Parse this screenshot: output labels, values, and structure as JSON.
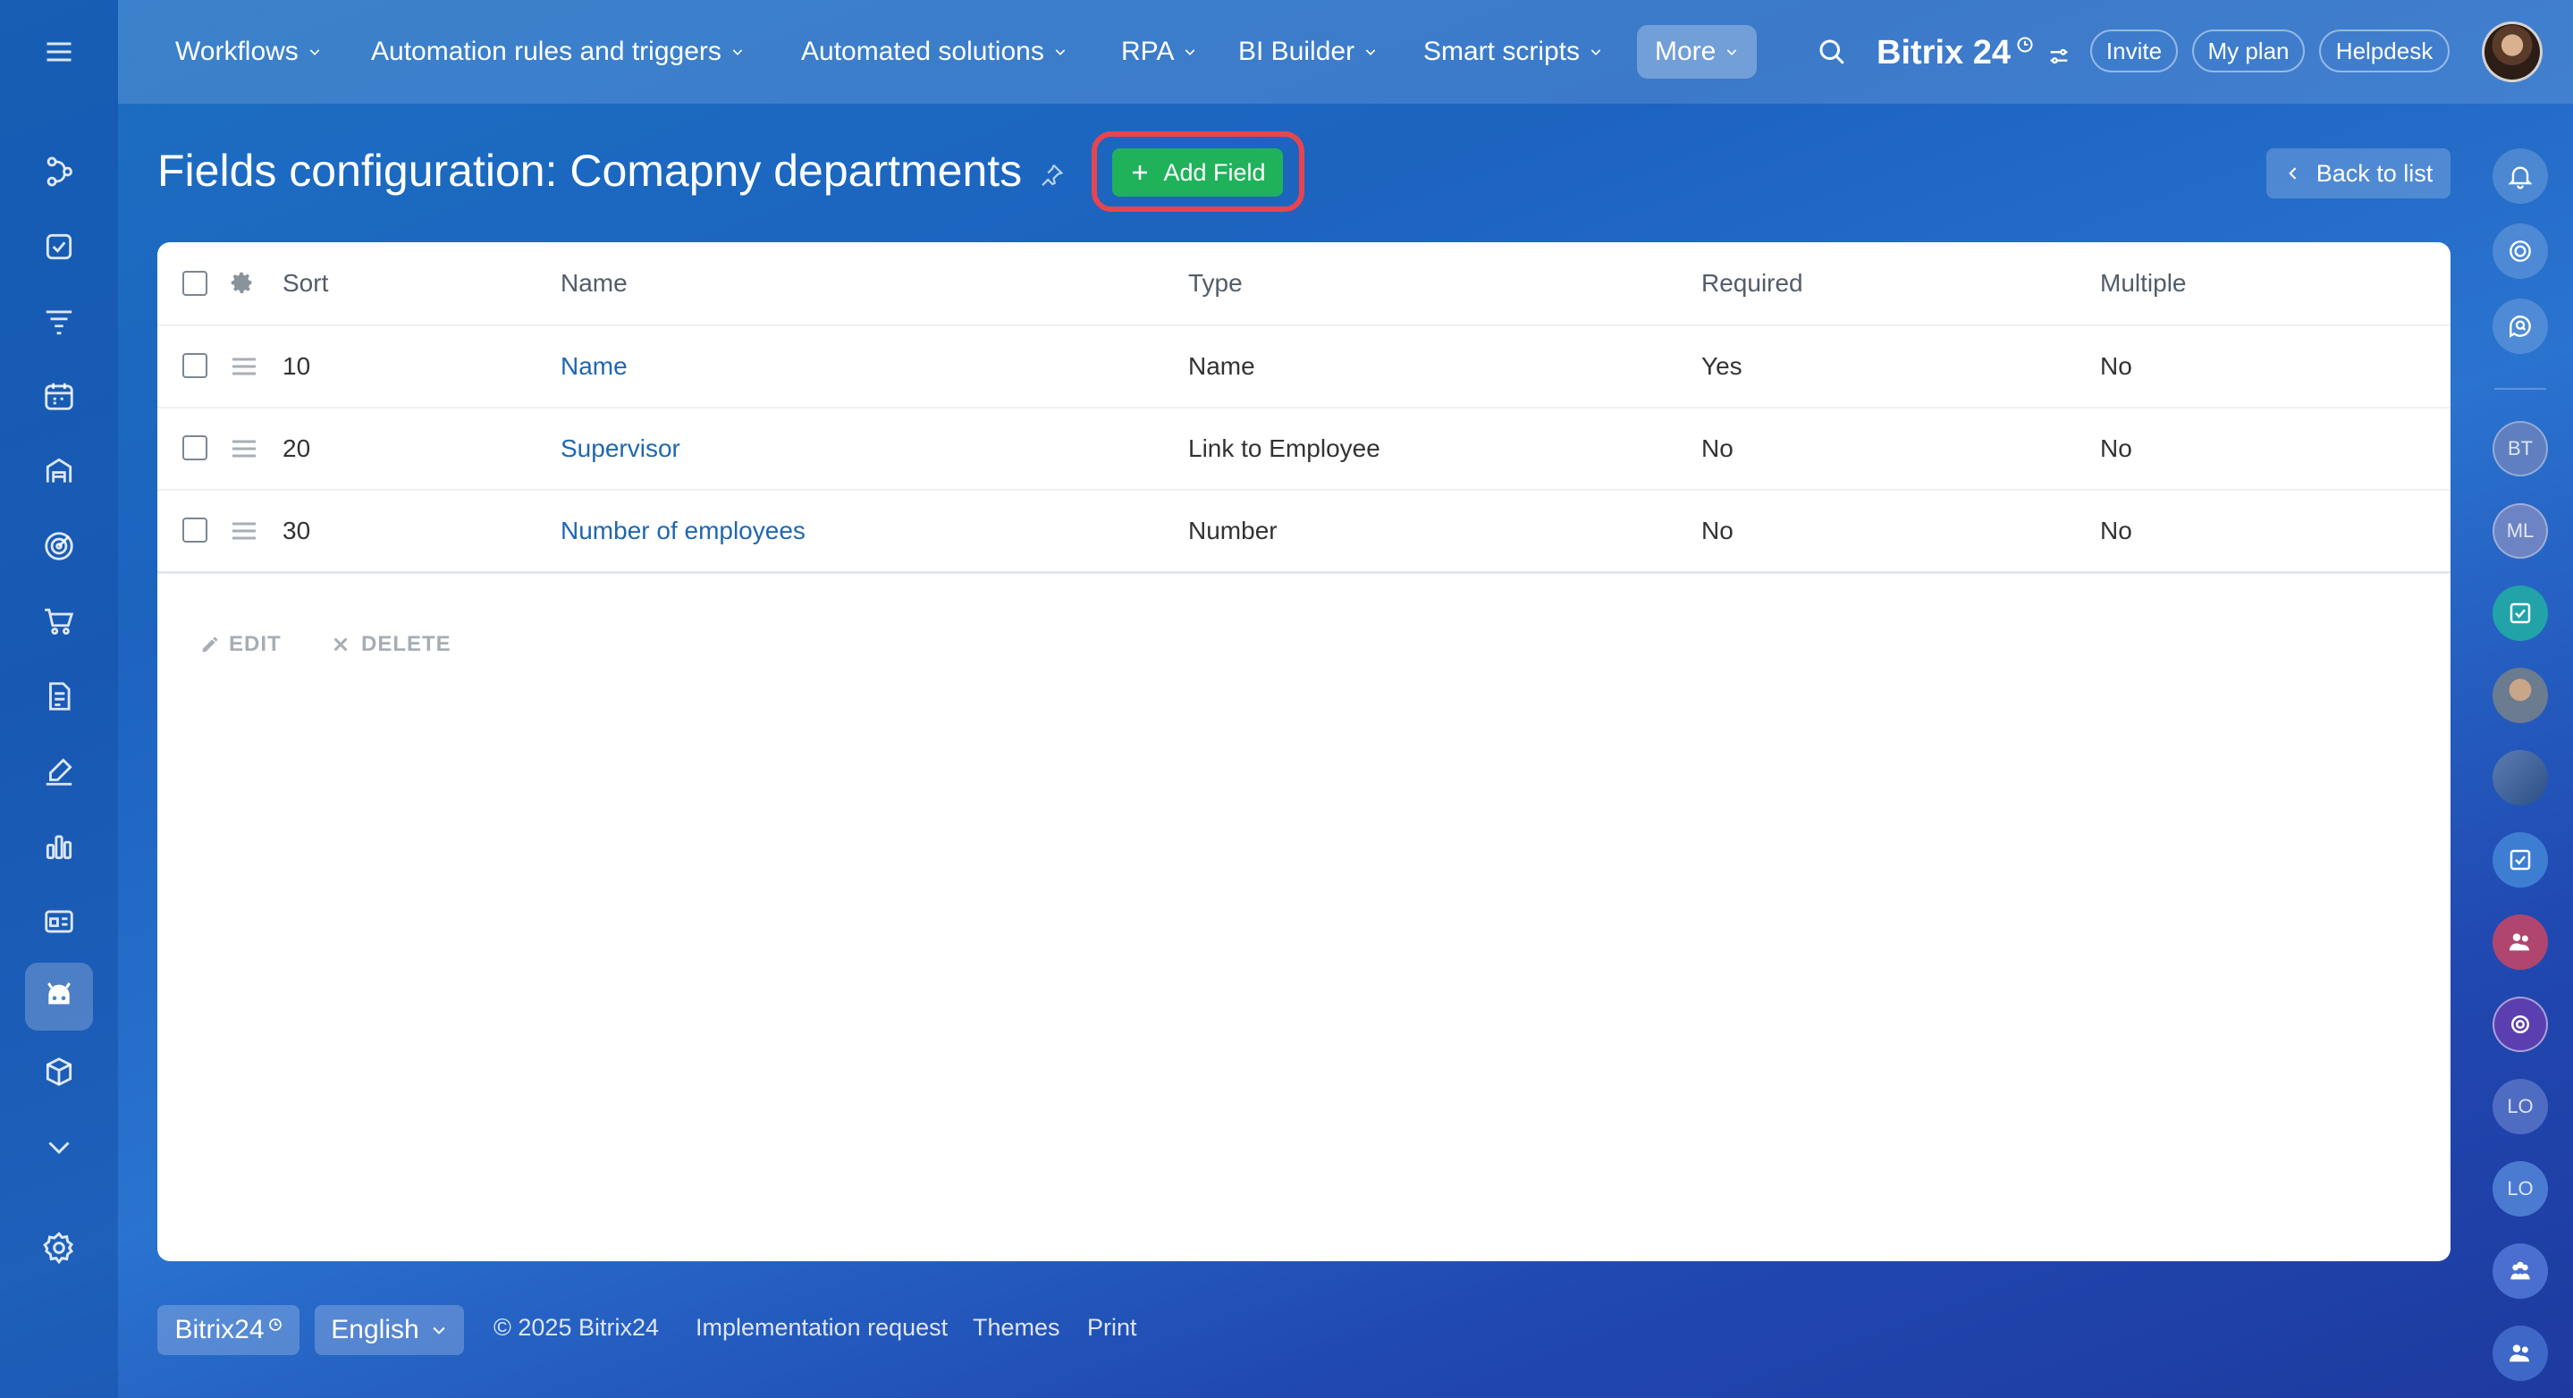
{
  "topnav": {
    "items": [
      "Workflows",
      "Automation rules and triggers",
      "Automated solutions",
      "RPA",
      "BI Builder",
      "Smart scripts"
    ],
    "more_label": "More",
    "brand": "Bitrix 24",
    "invite_label": "Invite",
    "myplan_label": "My plan",
    "helpdesk_label": "Helpdesk"
  },
  "leftnav": {
    "icons": [
      "menu-icon",
      "flow-icon",
      "task-icon",
      "funnel-icon",
      "calendar-icon",
      "store-icon",
      "target-icon",
      "cart-icon",
      "document-icon",
      "signature-icon",
      "analytics-icon",
      "card-icon",
      "robot-icon",
      "box-icon",
      "chevron-down-icon",
      "settings-icon"
    ],
    "active": "robot-icon"
  },
  "rightbar": {
    "avatars": [
      "BT",
      "ML",
      "",
      "",
      "",
      "",
      "",
      "",
      "LO",
      "LO",
      "",
      ""
    ]
  },
  "page": {
    "title": "Fields configuration: Comapny departments",
    "add_field_label": "Add Field",
    "back_label": "Back to list"
  },
  "table": {
    "headers": {
      "sort": "Sort",
      "name": "Name",
      "type": "Type",
      "required": "Required",
      "multiple": "Multiple"
    },
    "rows": [
      {
        "sort": "10",
        "name": "Name",
        "type": "Name",
        "required": "Yes",
        "multiple": "No"
      },
      {
        "sort": "20",
        "name": "Supervisor",
        "type": "Link to Employee",
        "required": "No",
        "multiple": "No"
      },
      {
        "sort": "30",
        "name": "Number of employees",
        "type": "Number",
        "required": "No",
        "multiple": "No"
      }
    ],
    "edit_label": "EDIT",
    "delete_label": "DELETE"
  },
  "footer": {
    "brand": "Bitrix24",
    "language": "English",
    "copyright": "© 2025 Bitrix24",
    "links": [
      "Implementation request",
      "Themes",
      "Print"
    ]
  },
  "colors": {
    "accent_green": "#1fb25a",
    "highlight_red": "#e8454f",
    "link_blue": "#2067b0"
  }
}
